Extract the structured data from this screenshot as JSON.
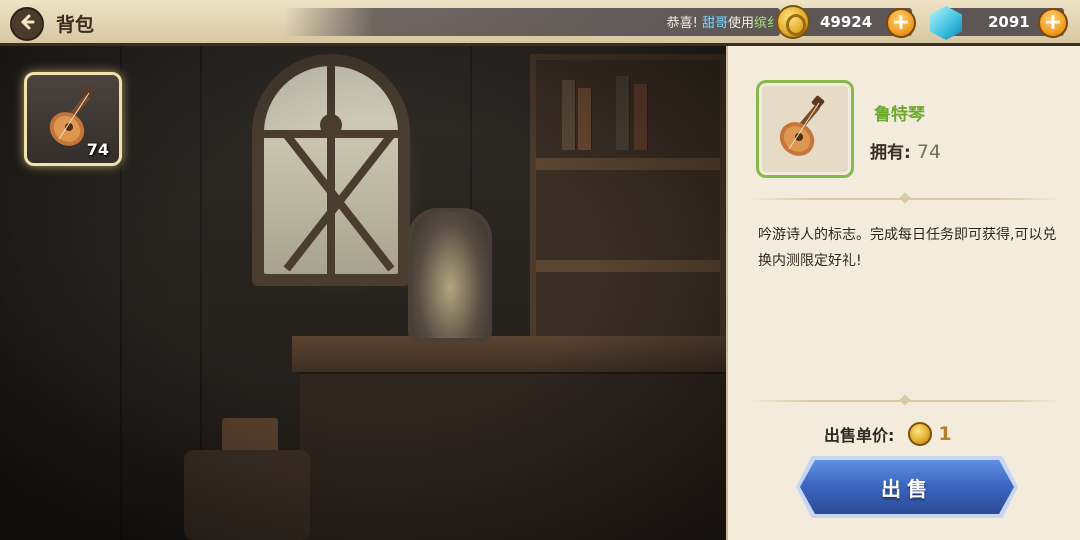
{
  "header": {
    "title": "背包",
    "back_icon": "back-arrow-icon",
    "news": {
      "prefix": "恭喜!",
      "user": "甜哥",
      "action": "使用",
      "item": "缤纟"
    }
  },
  "currencies": {
    "gold": {
      "icon": "gold-coin-icon",
      "amount": "49924",
      "add_label": "+"
    },
    "gem": {
      "icon": "blue-gem-icon",
      "amount": "2091",
      "add_label": "+"
    }
  },
  "inventory": {
    "items": [
      {
        "name": "鲁特琴",
        "icon": "lute-icon",
        "quantity": "74",
        "selected": true
      }
    ]
  },
  "detail": {
    "name": "鲁特琴",
    "owned_label": "拥有:",
    "owned_value": "74",
    "description": "吟游诗人的标志。完成每日任务即可获得,可以兑换内测限定好礼!",
    "price_label": "出售单价:",
    "price_value": "1",
    "sell_label": "出售"
  },
  "colors": {
    "item_name": "#6aaa2c",
    "sell_button": "#3a64bf",
    "plus_button": "#f09b1e",
    "news_user": "#7fd6ff",
    "news_item": "#9fe07a"
  }
}
